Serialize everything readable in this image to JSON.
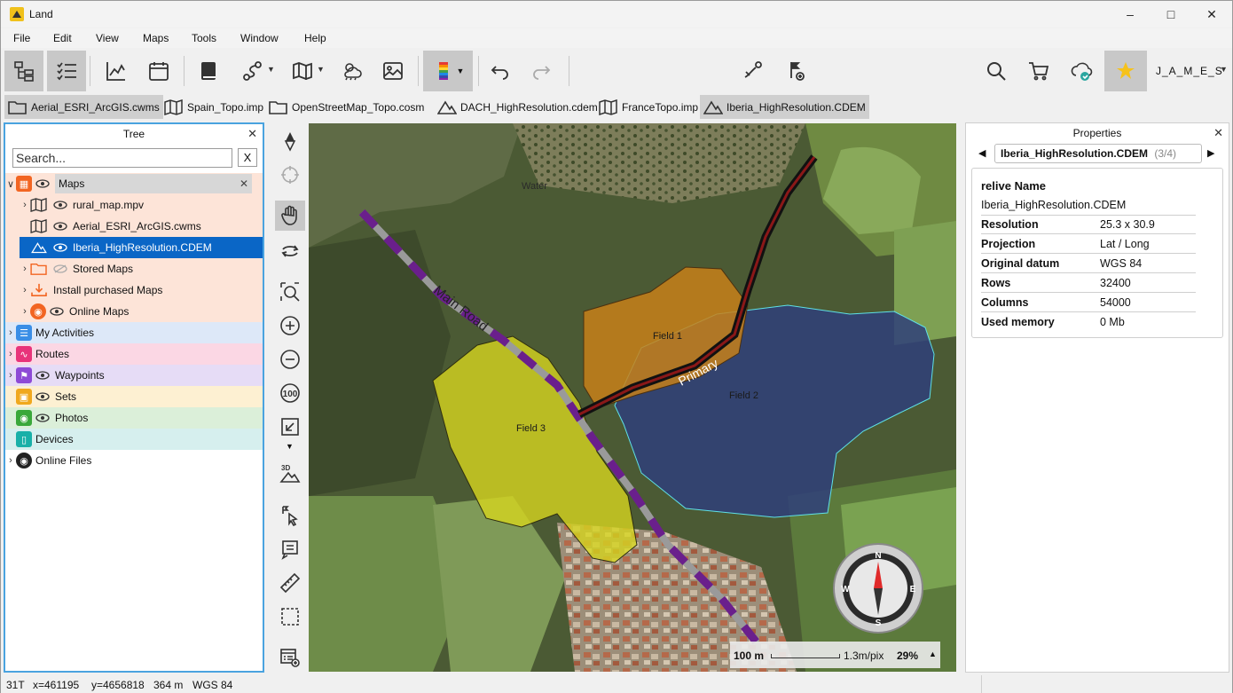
{
  "window": {
    "title": "Land",
    "controls": [
      "minimize",
      "maximize",
      "close"
    ]
  },
  "menu": [
    "File",
    "Edit",
    "View",
    "Maps",
    "Tools",
    "Window",
    "Help"
  ],
  "toolbar": {
    "user_label": "J_A_M_E_S"
  },
  "tabs": [
    {
      "label": "Aerial_ESRI_ArcGIS.cwms",
      "icon": "folder-icon",
      "selected": true
    },
    {
      "label": "Spain_Topo.imp",
      "icon": "map-icon",
      "selected": false
    },
    {
      "label": "OpenStreetMap_Topo.cosm",
      "icon": "folder-icon",
      "selected": false
    },
    {
      "label": "DACH_HighResolution.cdem",
      "icon": "mountain-icon",
      "selected": false
    },
    {
      "label": "FranceTopo.imp",
      "icon": "map-icon",
      "selected": false
    },
    {
      "label": "Iberia_HighResolution.CDEM",
      "icon": "mountain-icon",
      "selected": true
    }
  ],
  "tree": {
    "title": "Tree",
    "search_placeholder": "Search...",
    "search_clear": "X",
    "items": [
      {
        "label": "Maps",
        "color": "#f26522"
      },
      {
        "label": "rural_map.mpv"
      },
      {
        "label": "Aerial_ESRI_ArcGIS.cwms"
      },
      {
        "label": "Iberia_HighResolution.CDEM"
      },
      {
        "label": "Stored Maps"
      },
      {
        "label": "Install purchased Maps"
      },
      {
        "label": "Online Maps"
      },
      {
        "label": "My Activities",
        "color": "#3a8ee6"
      },
      {
        "label": "Routes",
        "color": "#e8337a"
      },
      {
        "label": "Waypoints",
        "color": "#8e4ad6"
      },
      {
        "label": "Sets",
        "color": "#f0a81e"
      },
      {
        "label": "Photos",
        "color": "#3aa83a"
      },
      {
        "label": "Devices",
        "color": "#18b0a8"
      },
      {
        "label": "Online Files"
      }
    ]
  },
  "map": {
    "labels": {
      "water": "Water",
      "road": "Main Road",
      "primary": "Primary",
      "field1": "Field 1",
      "field2": "Field 2",
      "field3": "Field 3"
    },
    "compass": {
      "n": "N",
      "s": "S",
      "e": "E",
      "w": "W"
    },
    "scale": {
      "distance": "100 m",
      "resolution": "1.3m/pix",
      "zoom": "29%"
    }
  },
  "properties": {
    "title": "Properties",
    "nav_label": "Iberia_HighResolution.CDEM",
    "nav_count": "(3/4)",
    "header": "relive Name",
    "name_value": "Iberia_HighResolution.CDEM",
    "rows": [
      {
        "key": "Resolution",
        "value": "25.3 x 30.9"
      },
      {
        "key": "Projection",
        "value": "Lat / Long"
      },
      {
        "key": "Original datum",
        "value": "WGS 84"
      },
      {
        "key": "Rows",
        "value": "32400"
      },
      {
        "key": "Columns",
        "value": "54000"
      },
      {
        "key": "Used memory",
        "value": "0 Mb"
      }
    ]
  },
  "status": {
    "zone": "31T",
    "x": "x=461195",
    "y": "y=4656818",
    "elev": "364 m",
    "datum": "WGS 84"
  }
}
